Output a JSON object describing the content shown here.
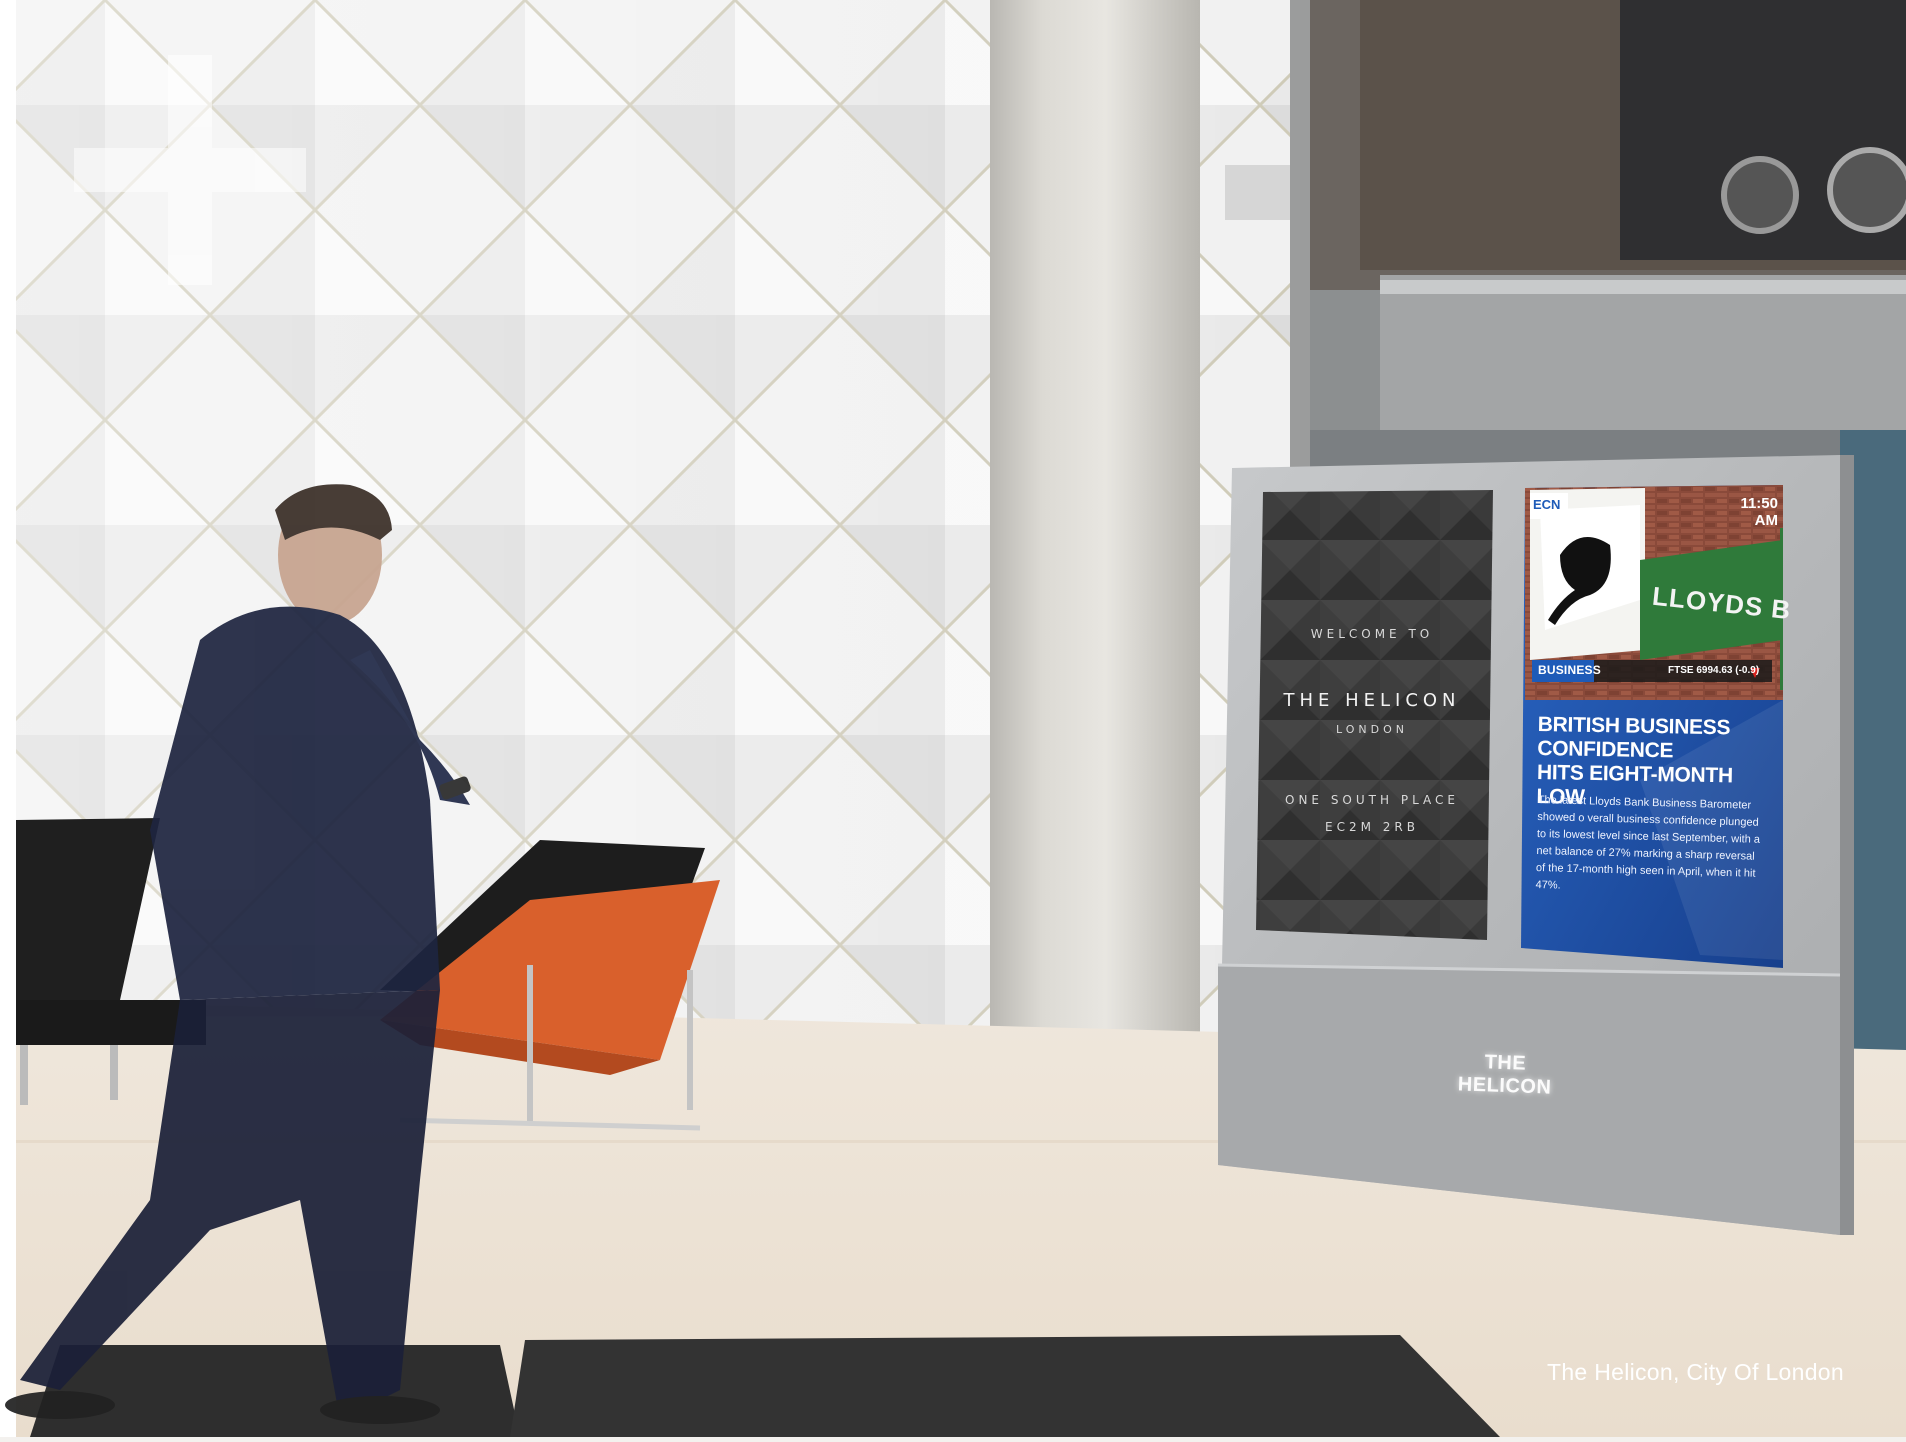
{
  "photo": {
    "caption": "The Helicon, City Of London"
  },
  "welcome_screen": {
    "welcome_to": "WELCOME TO",
    "title": "THE HELICON",
    "city": "LONDON",
    "address_line1": "ONE SOUTH PLACE",
    "address_line2": "EC2M 2RB"
  },
  "news_screen": {
    "logo": "ECN",
    "time": "11:50 AM",
    "sign_text": "LLOYDS B",
    "category": "BUSINESS",
    "ticker": "FTSE 6994.63 (-0.9)",
    "ticker_direction": "down",
    "headline_line1": "BRITISH BUSINESS CONFIDENCE",
    "headline_line2": "HITS EIGHT-MONTH LOW",
    "body": "The latest Lloyds Bank Business Barometer showed o verall business confidence plunged to its lowest level since last September, with a net balance of 27% marking a sharp reversal of the 17-month high seen in April, when it hit 47%."
  },
  "kiosk": {
    "label": "THE HELICON"
  },
  "colors": {
    "news_blue": "#1e5bb8",
    "orange_chair": "#d9602c",
    "ticker_red": "#d6231f"
  }
}
